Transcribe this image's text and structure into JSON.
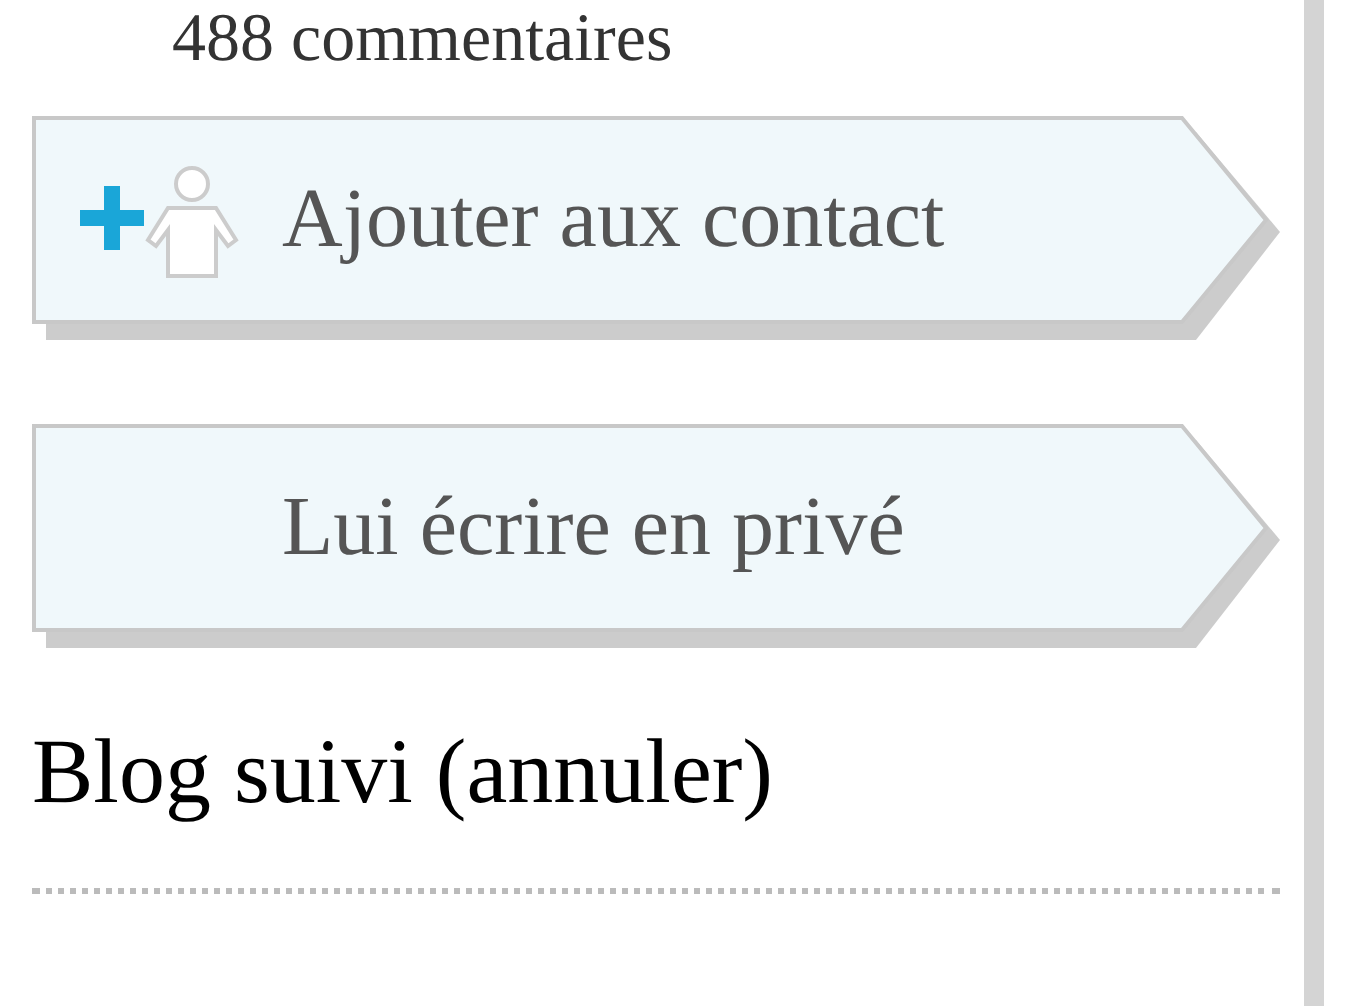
{
  "comments_count": "488 commentaires",
  "actions": [
    {
      "label": "Ajouter aux contact",
      "kind": "add-contact"
    },
    {
      "label": "Lui écrire en privé",
      "kind": "message"
    }
  ],
  "follow_status": "Blog suivi (annuler)"
}
